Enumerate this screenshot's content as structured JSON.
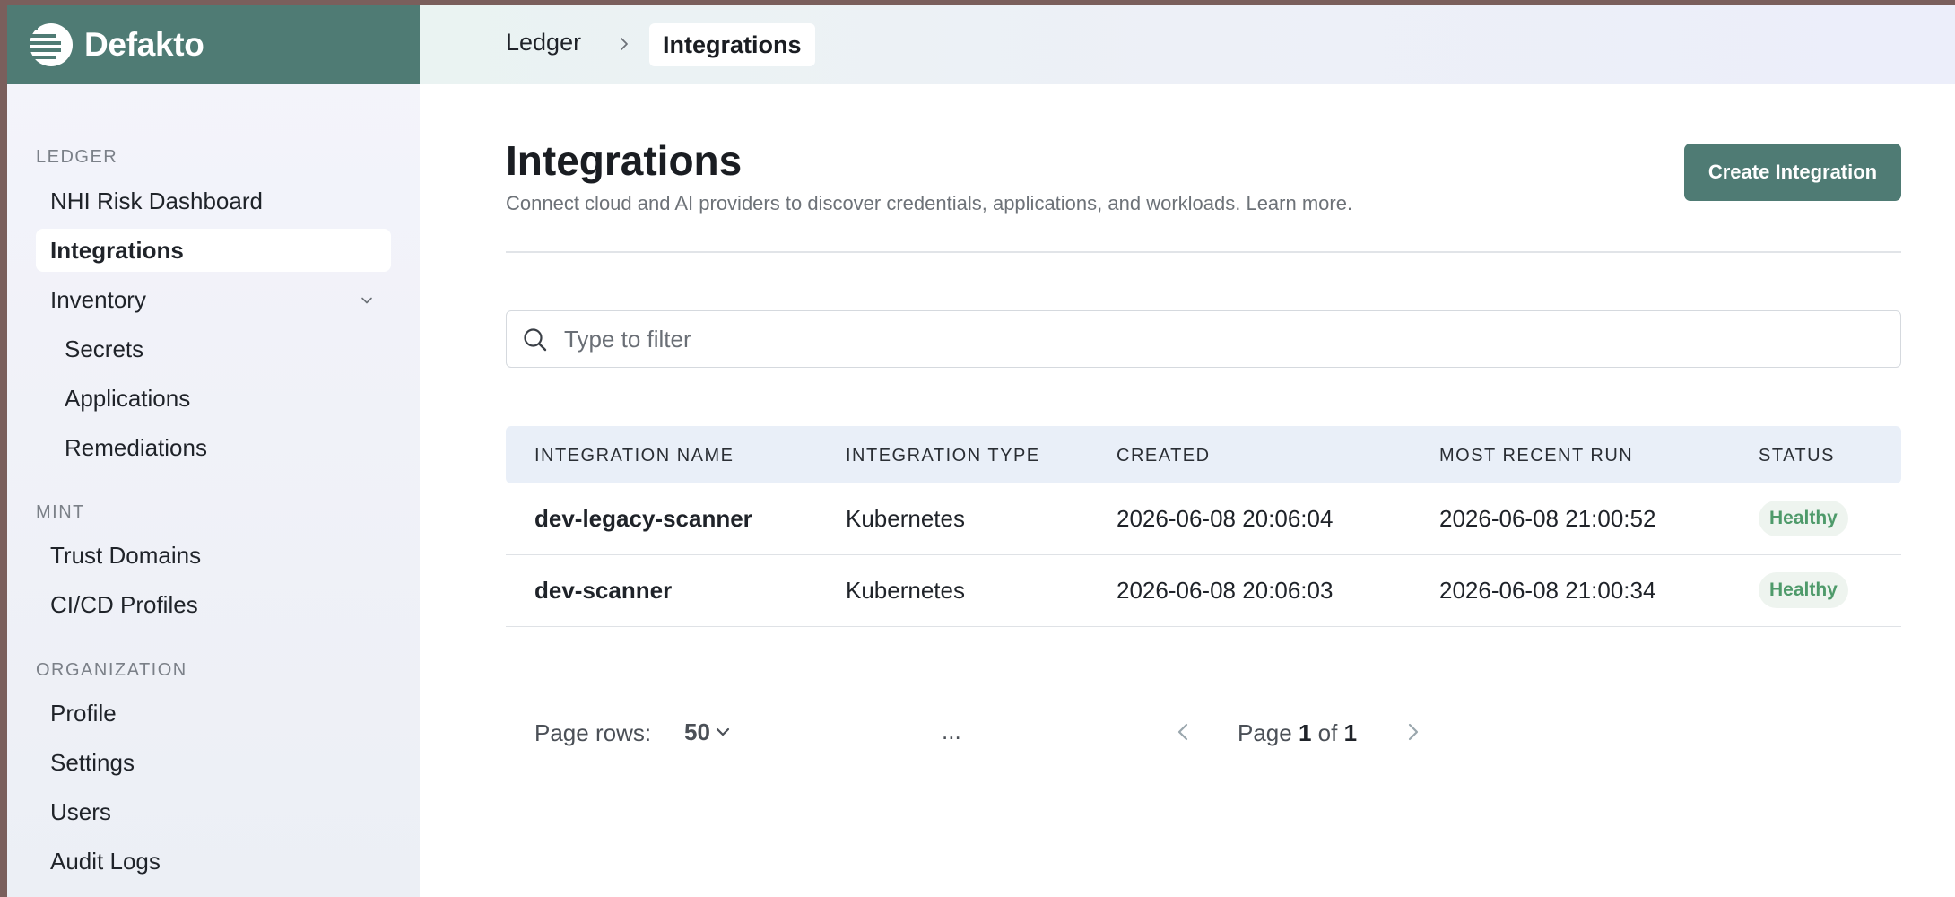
{
  "brand": {
    "name": "Defakto"
  },
  "sidebar": {
    "sections": [
      {
        "label": "LEDGER"
      },
      {
        "label": "MINT"
      },
      {
        "label": "ORGANIZATION"
      }
    ],
    "items": [
      {
        "label": "NHI Risk Dashboard"
      },
      {
        "label": "Integrations"
      },
      {
        "label": "Inventory"
      },
      {
        "label": "Secrets"
      },
      {
        "label": "Applications"
      },
      {
        "label": "Remediations"
      },
      {
        "label": "Trust Domains"
      },
      {
        "label": "CI/CD Profiles"
      },
      {
        "label": "Profile"
      },
      {
        "label": "Settings"
      },
      {
        "label": "Users"
      },
      {
        "label": "Audit Logs"
      }
    ]
  },
  "breadcrumb": {
    "root": "Ledger",
    "current": "Integrations"
  },
  "page": {
    "title": "Integrations",
    "subtitle": "Connect cloud and AI providers to discover credentials, applications, and workloads. Learn more.",
    "create_label": "Create Integration"
  },
  "search": {
    "placeholder": "Type to filter",
    "value": ""
  },
  "table": {
    "columns": [
      "INTEGRATION NAME",
      "INTEGRATION TYPE",
      "CREATED",
      "MOST RECENT RUN",
      "STATUS"
    ],
    "rows": [
      {
        "name": "dev-legacy-scanner",
        "type": "Kubernetes",
        "created": "2026-06-08 20:06:04",
        "recent_run": "2026-06-08 21:00:52",
        "status": "Healthy"
      },
      {
        "name": "dev-scanner",
        "type": "Kubernetes",
        "created": "2026-06-08 20:06:03",
        "recent_run": "2026-06-08 21:00:34",
        "status": "Healthy"
      }
    ]
  },
  "pagination": {
    "rows_label": "Page rows:",
    "rows_value": "50",
    "ellipsis": "...",
    "page_word": "Page",
    "current": "1",
    "of_word": "of",
    "total": "1"
  },
  "colors": {
    "brand": "#4f7b74",
    "status_healthy": "#4e9a6a"
  }
}
